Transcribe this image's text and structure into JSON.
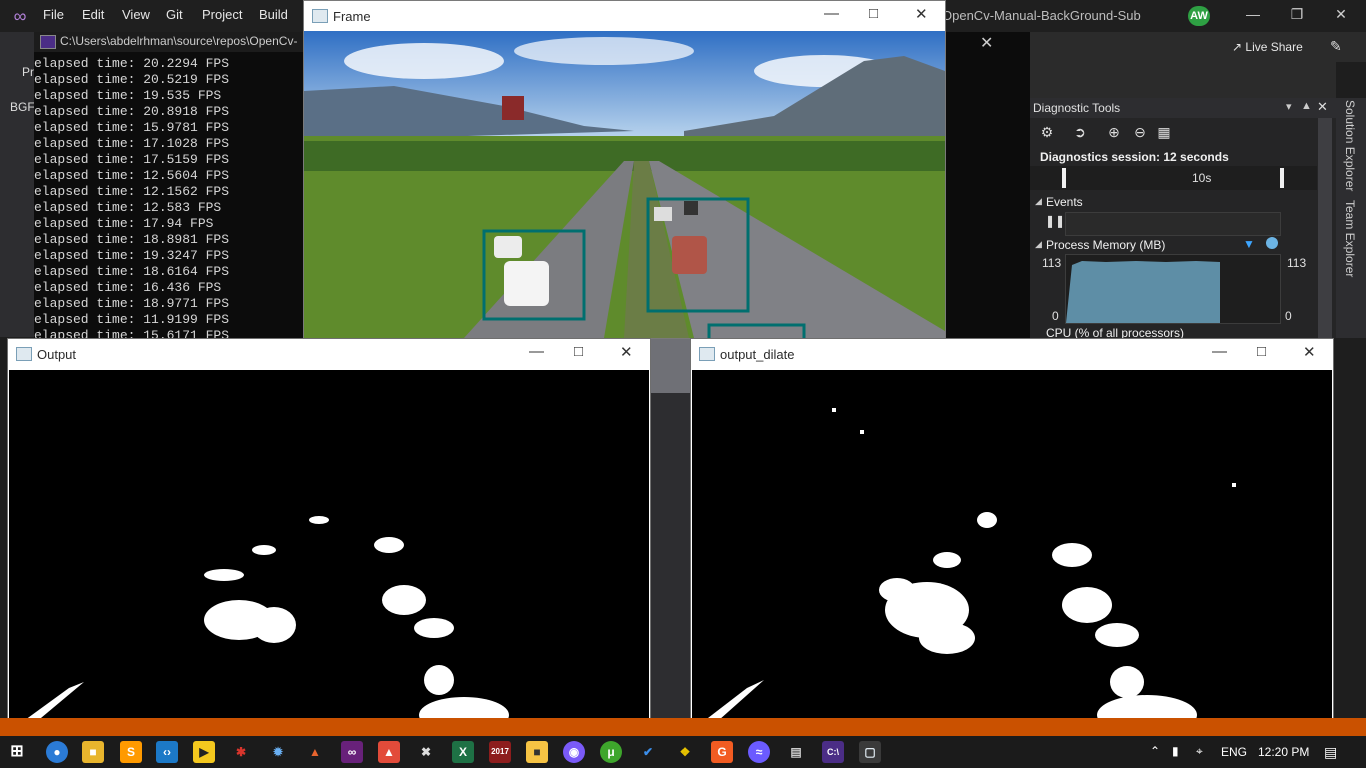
{
  "vs": {
    "menu": [
      "File",
      "Edit",
      "View",
      "Git",
      "Project",
      "Build"
    ],
    "title": "OpenCv-Manual-BackGround-Sub",
    "avatar": "AW",
    "live_share": "Live Share",
    "left_pr": "Pr",
    "left_bgf": "BGF"
  },
  "console": {
    "path": "C:\\Users\\abdelrhman\\source\\repos\\OpenCv-",
    "lines": [
      "elapsed time: 20.2294 FPS",
      "elapsed time: 20.5219 FPS",
      "elapsed time: 19.535 FPS",
      "elapsed time: 20.8918 FPS",
      "elapsed time: 15.9781 FPS",
      "elapsed time: 17.1028 FPS",
      "elapsed time: 17.5159 FPS",
      "elapsed time: 12.5604 FPS",
      "elapsed time: 12.1562 FPS",
      "elapsed time: 12.583 FPS",
      "elapsed time: 17.94 FPS",
      "elapsed time: 18.8981 FPS",
      "elapsed time: 19.3247 FPS",
      "elapsed time: 18.6164 FPS",
      "elapsed time: 16.436 FPS",
      "elapsed time: 18.9771 FPS",
      "elapsed time: 11.9199 FPS",
      "elapsed time: 15.6171 FPS"
    ]
  },
  "windows": {
    "frame": {
      "title": "Frame"
    },
    "output": {
      "title": "Output"
    },
    "output_dilate": {
      "title": "output_dilate"
    }
  },
  "diagnostics": {
    "title": "Diagnostic Tools",
    "session": "Diagnostics session: 12 seconds",
    "timeline_label": "10s",
    "events": "Events",
    "process_memory": "Process Memory (MB)",
    "mem_max": "113",
    "mem_min": "0",
    "cpu": "CPU (% of all processors)",
    "side_tabs": [
      "Solution Explorer",
      "Team Explorer"
    ]
  },
  "taskbar": {
    "lang": "ENG",
    "time": "12:20 PM"
  },
  "colors": {
    "vs_status": "#ca5100",
    "detect_box": "#006f6f",
    "memory_fill": "#5e8ea6"
  }
}
